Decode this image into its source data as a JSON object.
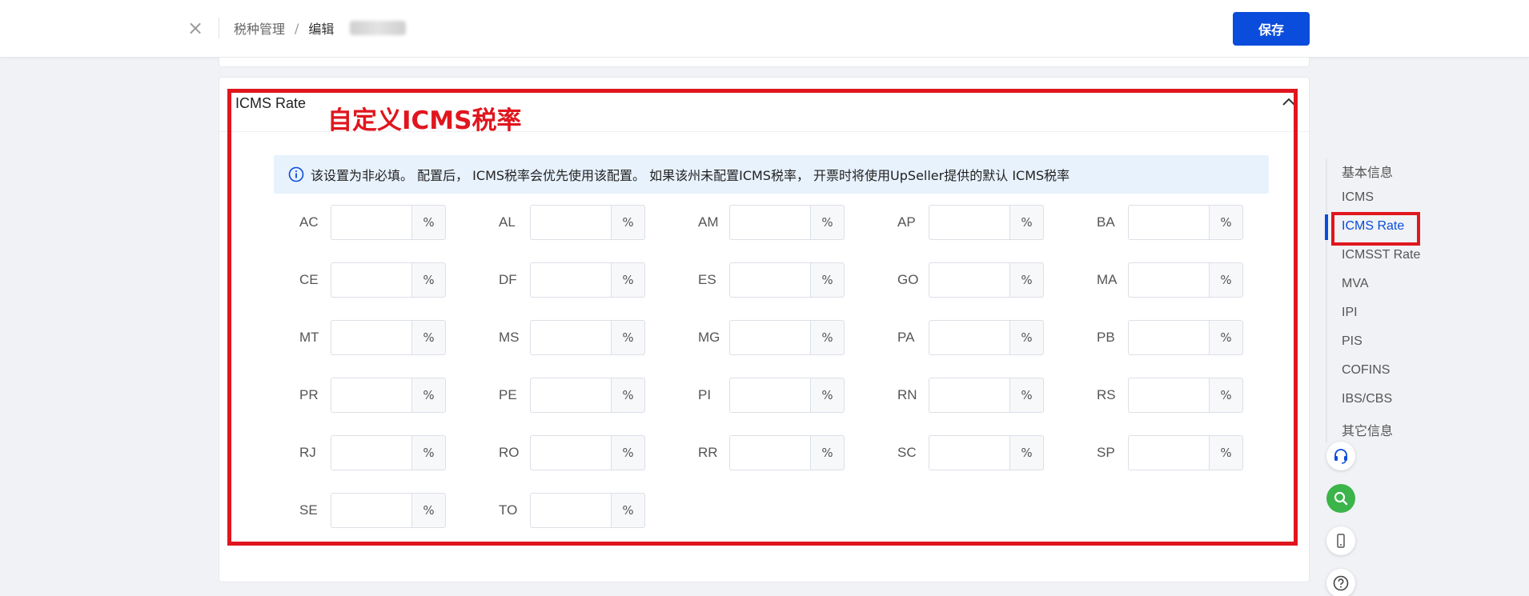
{
  "header": {
    "breadcrumb": [
      "税种管理",
      "/",
      "编辑"
    ],
    "save_label": "保存"
  },
  "section": {
    "title": "ICMS Rate",
    "annotation": "自定义ICMS税率",
    "notice": "该设置为非必填。 配置后， ICMS税率会优先使用该配置。 如果该州未配置ICMS税率， 开票时将使用UpSeller提供的默认 ICMS税率"
  },
  "rates": {
    "unit": "%",
    "states": [
      {
        "code": "AC",
        "value": ""
      },
      {
        "code": "AL",
        "value": ""
      },
      {
        "code": "AM",
        "value": ""
      },
      {
        "code": "AP",
        "value": ""
      },
      {
        "code": "BA",
        "value": ""
      },
      {
        "code": "CE",
        "value": ""
      },
      {
        "code": "DF",
        "value": ""
      },
      {
        "code": "ES",
        "value": ""
      },
      {
        "code": "GO",
        "value": ""
      },
      {
        "code": "MA",
        "value": ""
      },
      {
        "code": "MT",
        "value": ""
      },
      {
        "code": "MS",
        "value": ""
      },
      {
        "code": "MG",
        "value": ""
      },
      {
        "code": "PA",
        "value": ""
      },
      {
        "code": "PB",
        "value": ""
      },
      {
        "code": "PR",
        "value": ""
      },
      {
        "code": "PE",
        "value": ""
      },
      {
        "code": "PI",
        "value": ""
      },
      {
        "code": "RN",
        "value": ""
      },
      {
        "code": "RS",
        "value": ""
      },
      {
        "code": "RJ",
        "value": ""
      },
      {
        "code": "RO",
        "value": ""
      },
      {
        "code": "RR",
        "value": ""
      },
      {
        "code": "SC",
        "value": ""
      },
      {
        "code": "SP",
        "value": ""
      },
      {
        "code": "SE",
        "value": ""
      },
      {
        "code": "TO",
        "value": ""
      }
    ]
  },
  "anchor_nav": {
    "items": [
      "基本信息",
      "ICMS",
      "ICMS Rate",
      "ICMSST Rate",
      "MVA",
      "IPI",
      "PIS",
      "COFINS",
      "IBS/CBS",
      "其它信息"
    ],
    "active": "ICMS Rate"
  },
  "floating": [
    "headset-icon",
    "search-icon",
    "mobile-icon",
    "help-icon"
  ],
  "colors": {
    "primary": "#0a4cdb",
    "annotation_red": "#e0161e",
    "notice_bg": "#e8f2fd",
    "fab_green": "#3bb44a"
  }
}
